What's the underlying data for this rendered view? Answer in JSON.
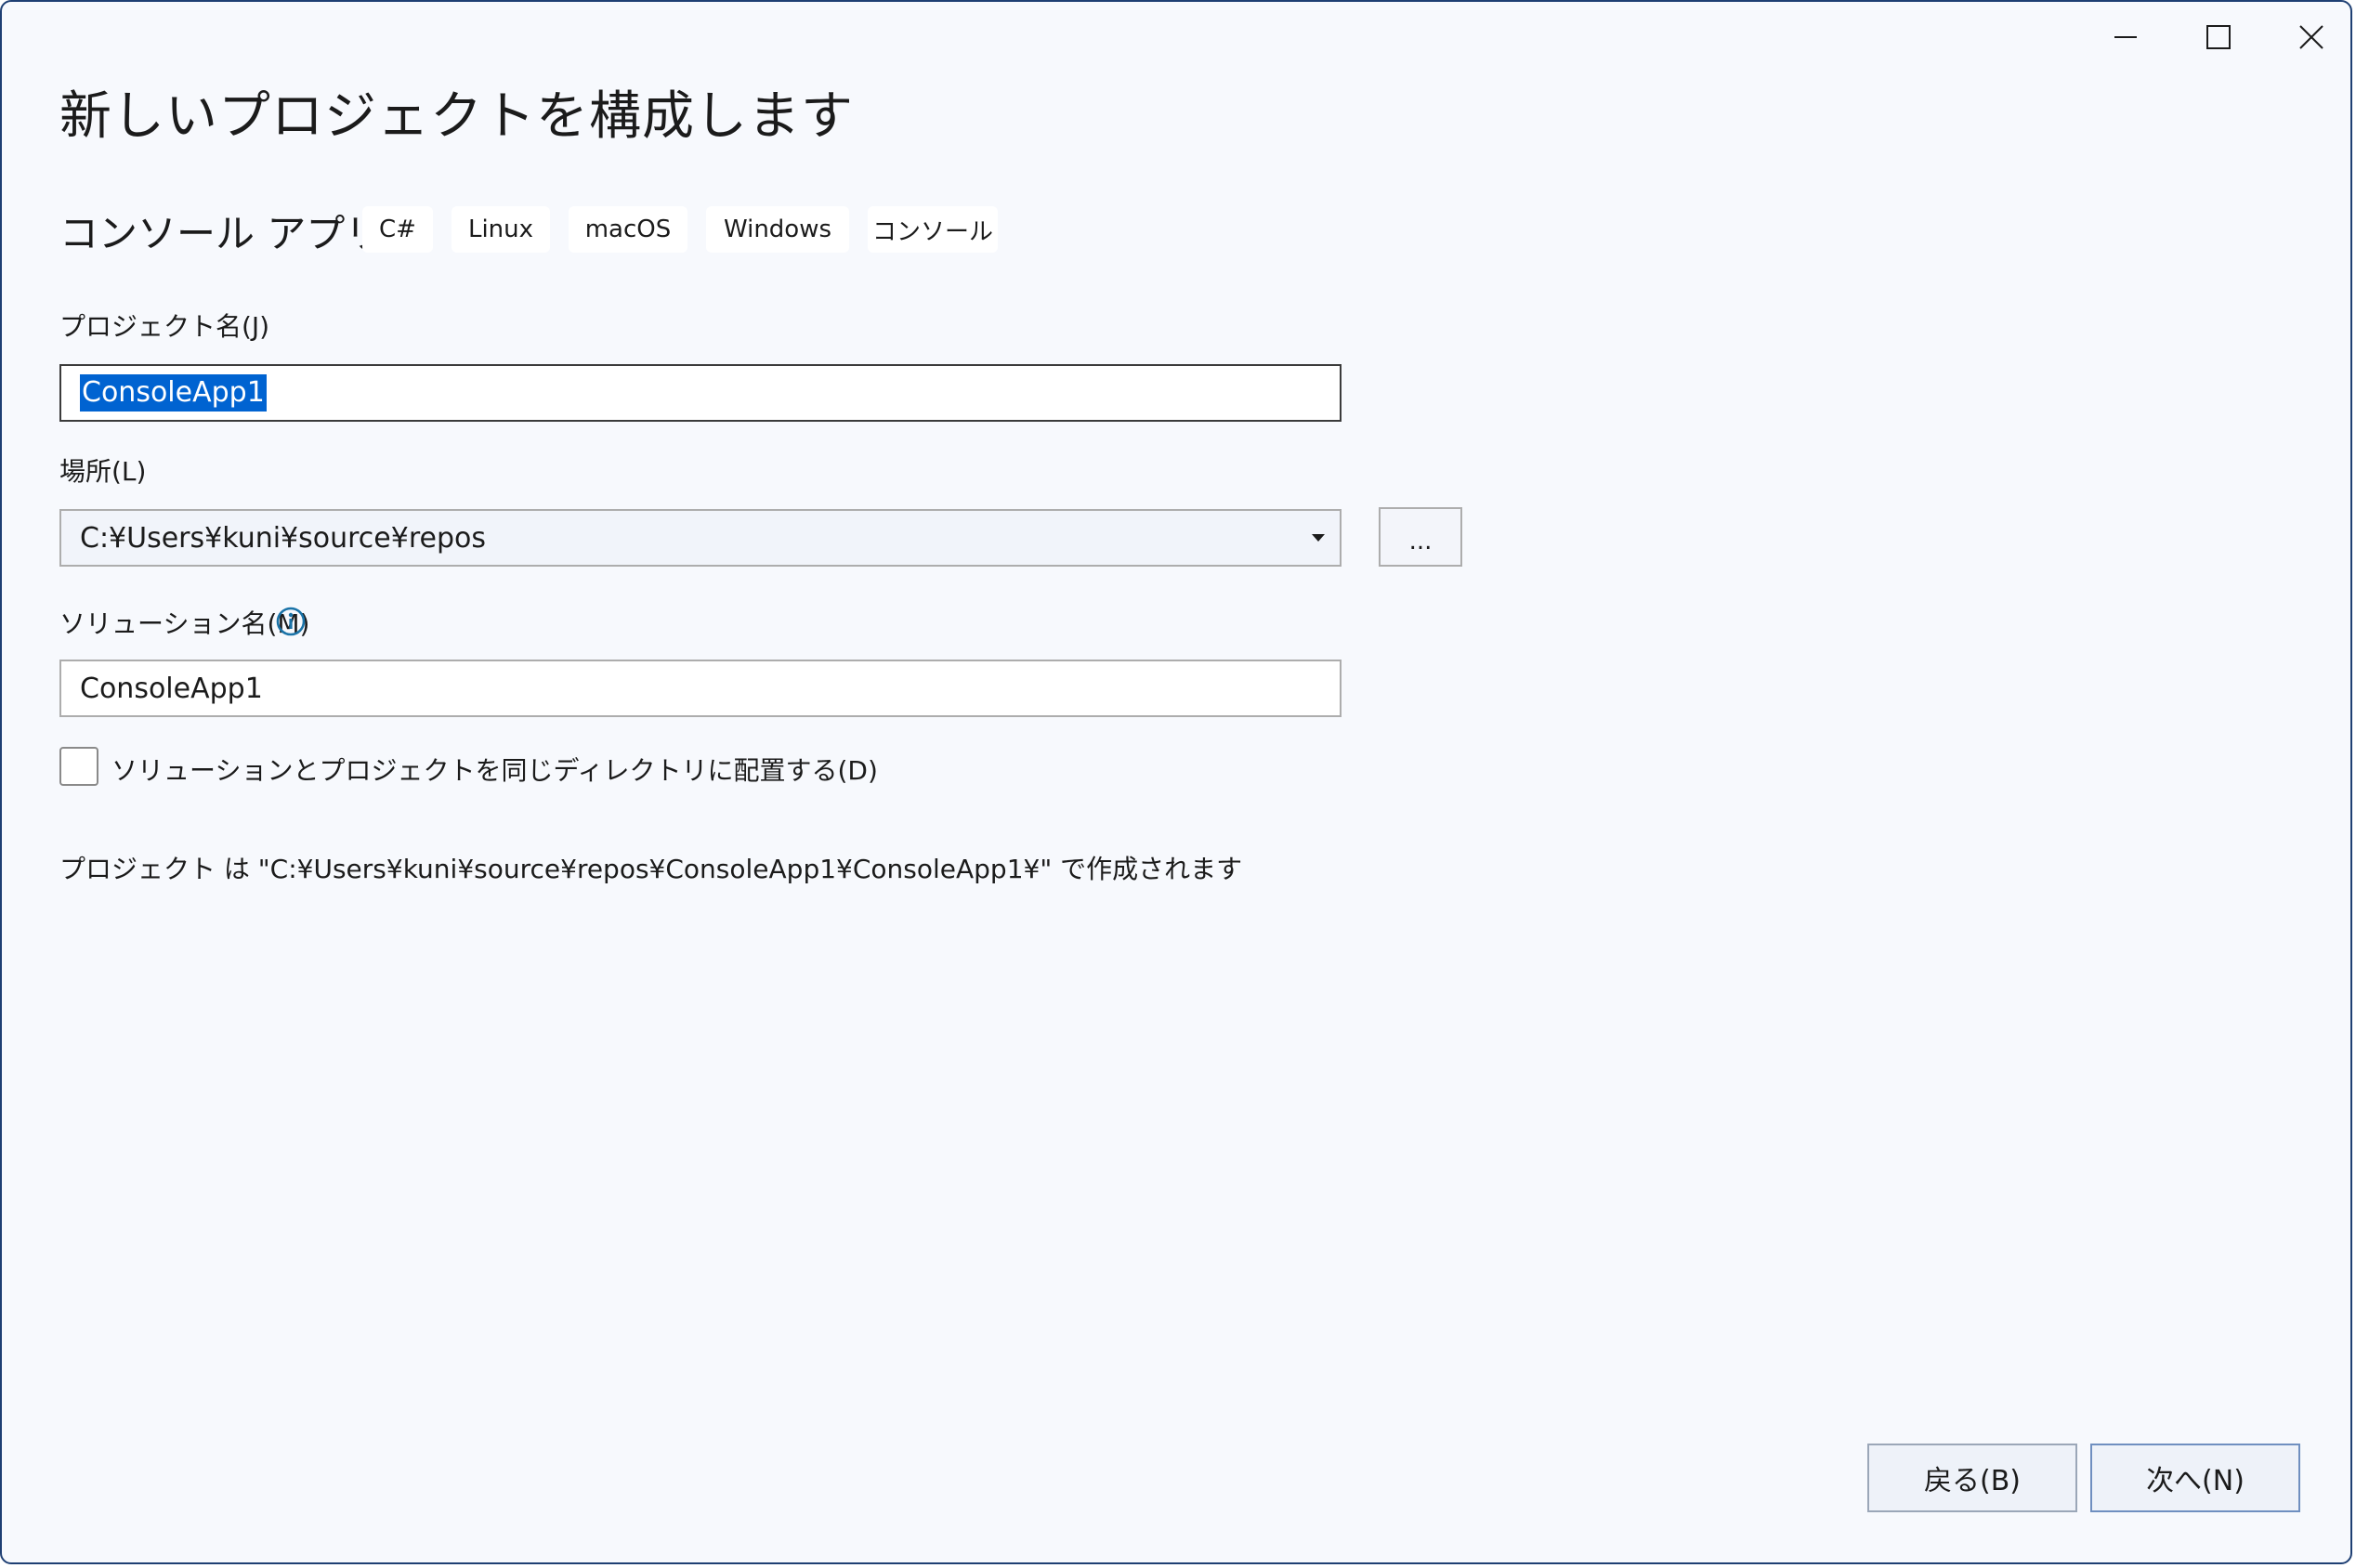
{
  "window": {
    "minimize_icon": "minimize-icon",
    "maximize_icon": "maximize-icon",
    "close_icon": "close-icon"
  },
  "header": {
    "title": "新しいプロジェクトを構成します",
    "template_name": "コンソール アプリ",
    "tags": [
      "C#",
      "Linux",
      "macOS",
      "Windows",
      "コンソール"
    ]
  },
  "form": {
    "project_name": {
      "label": "プロジェクト名(J)",
      "value": "ConsoleApp1"
    },
    "location": {
      "label": "場所(L)",
      "value": "C:¥Users¥kuni¥source¥repos",
      "browse_label": "..."
    },
    "solution_name": {
      "label": "ソリューション名(M)",
      "value": "ConsoleApp1",
      "info_icon": "info-icon"
    },
    "same_directory": {
      "label": "ソリューションとプロジェクトを同じディレクトリに配置する(D)",
      "checked": false
    },
    "path_note": "プロジェクト は \"C:¥Users¥kuni¥source¥repos¥ConsoleApp1¥ConsoleApp1¥\" で作成されます"
  },
  "footer": {
    "back_label": "戻る(B)",
    "next_label": "次へ(N)"
  },
  "colors": {
    "background": "#f7f9fd",
    "border": "#1e3f73",
    "selection": "#0063d1",
    "info": "#1a73a8"
  }
}
